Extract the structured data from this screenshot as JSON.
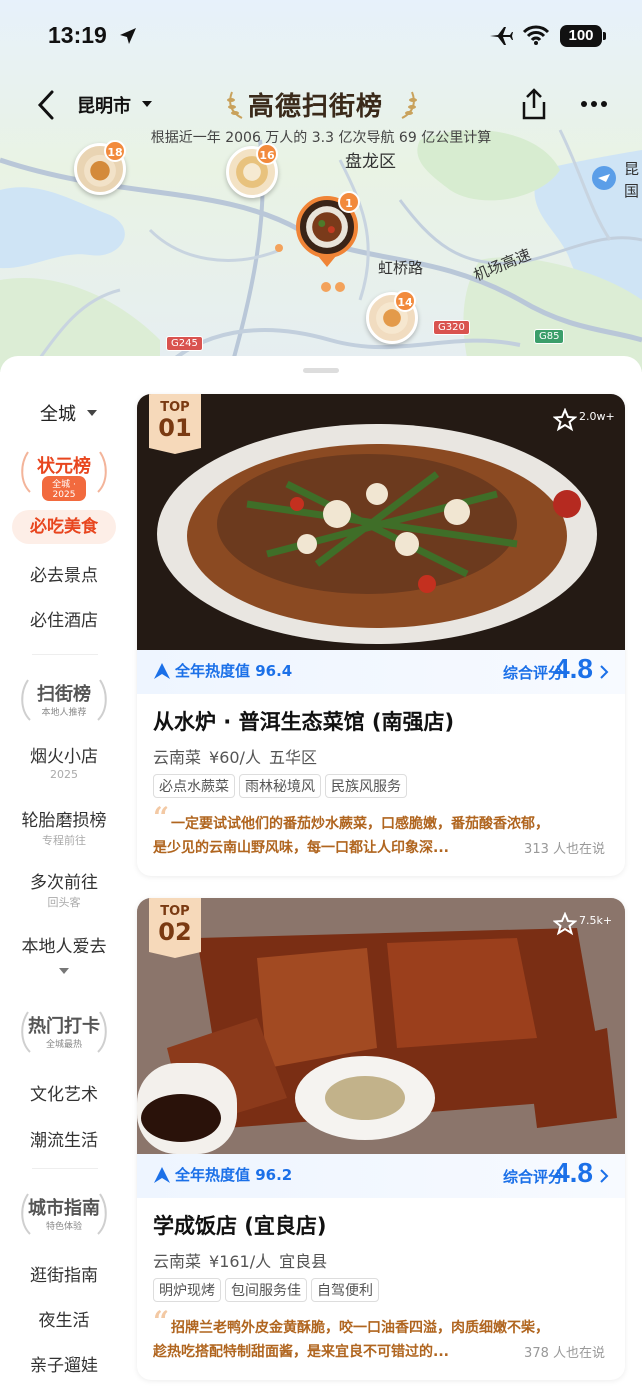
{
  "status_bar": {
    "time": "13:19",
    "battery": "100"
  },
  "header": {
    "city": "昆明市",
    "brand": "高德扫街榜",
    "subtitle": "根据近一年 2006 万人的 3.3 亿次导航 69 亿公里计算"
  },
  "map": {
    "labels": [
      "盘龙区",
      "虹桥路",
      "机场高速",
      "昆",
      "国"
    ],
    "roads": [
      "G320",
      "G245",
      "G85"
    ],
    "pins": [
      {
        "rank": "18",
        "icon": "noodle-bowl-icon"
      },
      {
        "rank": "16",
        "icon": "soup-bowl-icon"
      },
      {
        "rank": "1",
        "icon": "stir-fry-dish-icon"
      },
      {
        "rank": "14",
        "icon": "noodle-bowl-icon"
      }
    ]
  },
  "sidebar": {
    "city_filter": "全城",
    "sections": [
      {
        "title": "状元榜",
        "sub": "全城 · 2025",
        "color": "#e8461f",
        "items": [
          {
            "label": "必吃美食",
            "active": true
          },
          {
            "label": "必去景点"
          },
          {
            "label": "必住酒店"
          }
        ]
      },
      {
        "title": "扫街榜",
        "sub": "本地人推荐",
        "color": "#555555",
        "items": [
          {
            "label": "烟火小店",
            "note": "2025"
          },
          {
            "label": "轮胎磨损榜",
            "note": "专程前往"
          },
          {
            "label": "多次前往",
            "note": "回头客"
          },
          {
            "label": "本地人爱去"
          }
        ]
      },
      {
        "title": "热门打卡",
        "sub": "全城最热",
        "color": "#555555",
        "items": [
          {
            "label": "文化艺术"
          },
          {
            "label": "潮流生活"
          }
        ]
      },
      {
        "title": "城市指南",
        "sub": "特色体验",
        "color": "#555555",
        "items": [
          {
            "label": "逛街指南"
          },
          {
            "label": "夜生活"
          },
          {
            "label": "亲子遛娃"
          }
        ]
      }
    ]
  },
  "cards": [
    {
      "rank_prefix": "TOP",
      "rank": "01",
      "favorites": "2.0w+",
      "heat_label": "全年热度值 96.4",
      "score_label": "综合评分",
      "score": "4.8",
      "name": "从水炉 · 普洱生态菜馆 (南强店)",
      "cuisine": "云南菜",
      "price": "¥60/人",
      "district": "五华区",
      "tags": [
        "必点水蕨菜",
        "雨林秘境风",
        "民族风服务"
      ],
      "review_line1": "一定要试试他们的番茄炒水蕨菜，口感脆嫩，番茄酸香浓郁，",
      "review_line2": "是少见的云南山野风味，每一口都让人印象深...",
      "also": "313 人也在说"
    },
    {
      "rank_prefix": "TOP",
      "rank": "02",
      "favorites": "7.5k+",
      "heat_label": "全年热度值 96.2",
      "score_label": "综合评分",
      "score": "4.8",
      "name": "学成饭店 (宜良店)",
      "cuisine": "云南菜",
      "price": "¥161/人",
      "district": "宜良县",
      "tags": [
        "明炉现烤",
        "包间服务佳",
        "自驾便利"
      ],
      "review_line1": "招牌兰老鸭外皮金黄酥脆，咬一口油香四溢，肉质细嫩不柴，",
      "review_line2": "趁热吃搭配特制甜面酱，是来宜良不可错过的...",
      "also": "378 人也在说"
    }
  ]
}
